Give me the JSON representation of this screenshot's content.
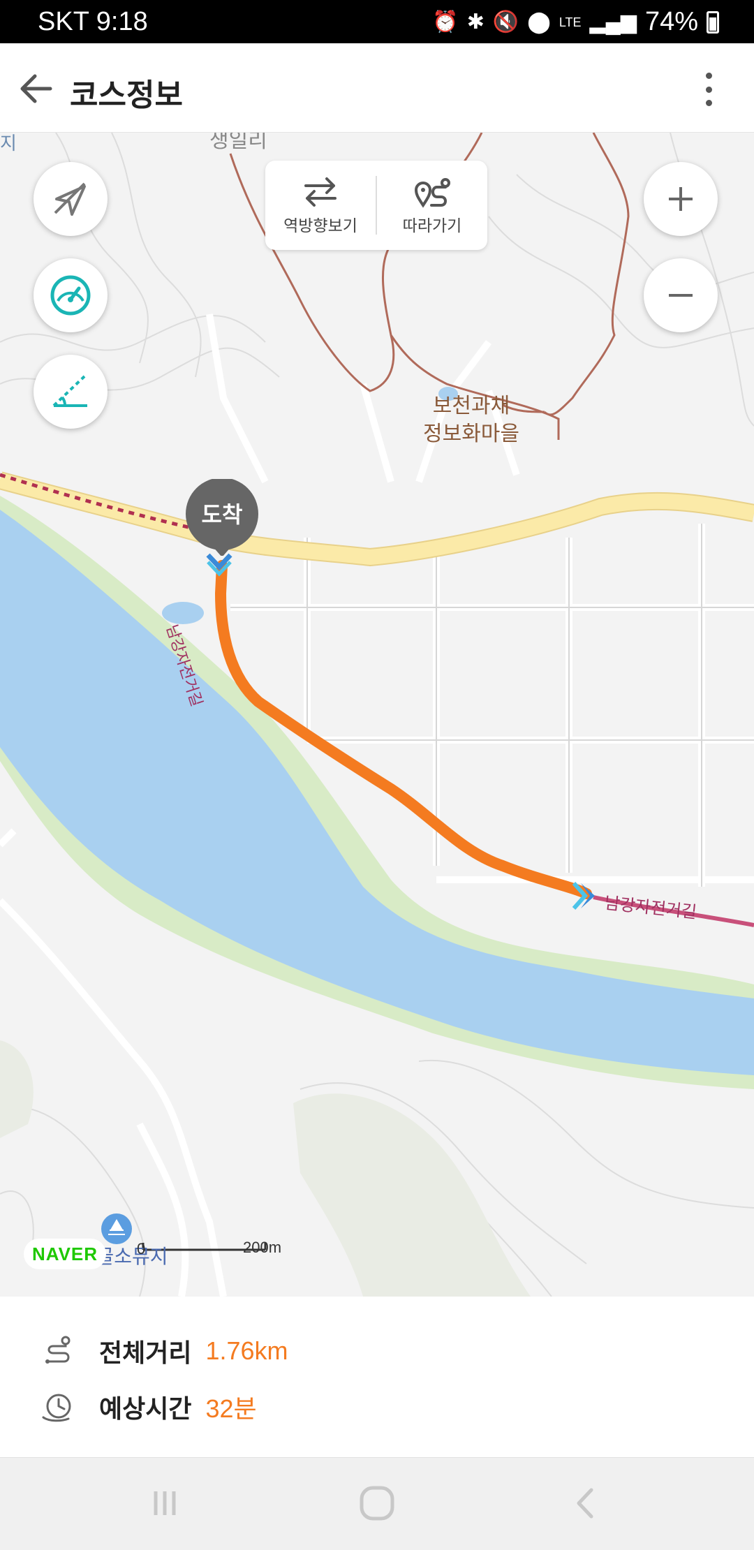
{
  "status_bar": {
    "carrier_time": "SKT 9:18",
    "network": "LTE",
    "battery": "74%"
  },
  "app_bar": {
    "title": "코스정보"
  },
  "map": {
    "toolbar": {
      "reverse_label": "역방향보기",
      "follow_label": "따라가기"
    },
    "labels": {
      "village": "보천과채\n정보화마을",
      "top_partial": "생일리",
      "left_partial": "지",
      "bottom_place": "오도골소뮤지",
      "route_name": "남강자전거길",
      "route_name_vertical": "남강자전거길"
    },
    "arrival_marker": "도착",
    "scale": {
      "zero": "0",
      "distance": "200m"
    },
    "logo": "NAVER"
  },
  "info": {
    "distance_label": "전체거리",
    "distance_value": "1.76km",
    "time_label": "예상시간",
    "time_value": "32분"
  },
  "colors": {
    "route": "#f47b20",
    "river": "#a9d0f0",
    "road": "#fbeaa8",
    "accent_teal": "#1ab5b5"
  }
}
